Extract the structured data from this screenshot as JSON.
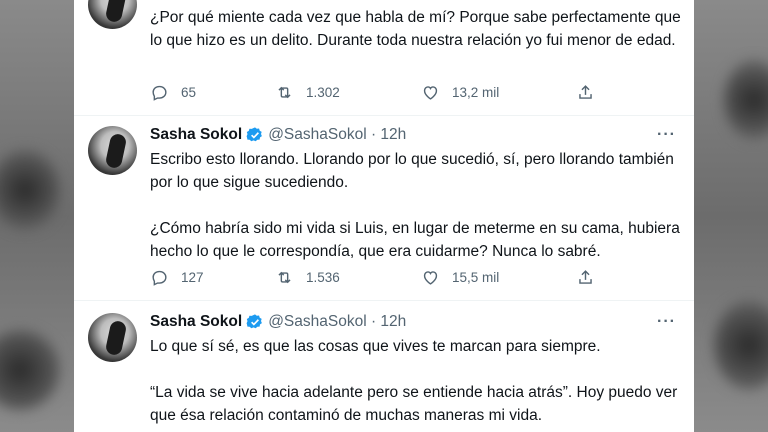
{
  "tweets": [
    {
      "partial": true,
      "text": "¿Por qué miente cada vez que habla de mí? Porque sabe perfectamente que lo que hizo es un delito. Durante toda nuestra relación yo fui menor de edad.",
      "replies": "65",
      "retweets": "1.302",
      "likes": "13,2 mil"
    },
    {
      "name": "Sasha Sokol",
      "handle": "@SashaSokol · 12h",
      "more": "···",
      "text": "Escribo esto llorando. Llorando por lo que sucedió, sí, pero llorando también por lo que sigue sucediendo.\n\n¿Cómo habría sido mi vida si Luis, en lugar de meterme en su cama, hubiera hecho lo que le correspondía, que era cuidarme? Nunca lo sabré.",
      "replies": "127",
      "retweets": "1.536",
      "likes": "15,5 mil"
    },
    {
      "name": "Sasha Sokol",
      "handle": "@SashaSokol · 12h",
      "more": "···",
      "text": "Lo que sí sé, es que las cosas que vives te marcan para siempre.\n\n“La vida se vive hacia adelante pero se entiende hacia atrás”. Hoy puedo ver que ésa relación contaminó de muchas maneras mi vida."
    }
  ],
  "colors": {
    "verified": "#1d9bf0",
    "muted": "#536471",
    "text": "#0f1419"
  },
  "icons": [
    "reply-icon",
    "retweet-icon",
    "like-icon",
    "share-icon",
    "verified-badge-icon",
    "more-icon"
  ]
}
